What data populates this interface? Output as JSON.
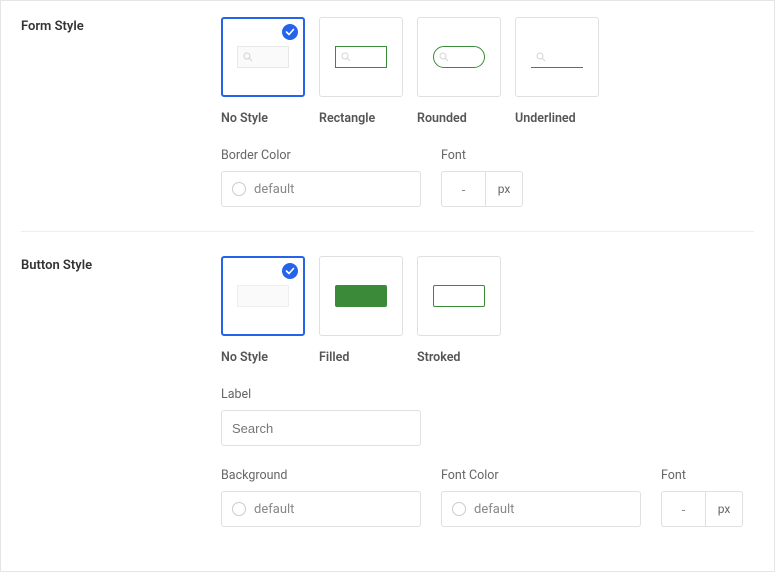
{
  "formStyle": {
    "sectionLabel": "Form Style",
    "options": {
      "noStyle": "No Style",
      "rectangle": "Rectangle",
      "rounded": "Rounded",
      "underlined": "Underlined"
    },
    "borderColor": {
      "label": "Border Color",
      "value": "default"
    },
    "font": {
      "label": "Font",
      "size": "-",
      "unit": "px"
    }
  },
  "buttonStyle": {
    "sectionLabel": "Button Style",
    "options": {
      "noStyle": "No Style",
      "filled": "Filled",
      "stroked": "Stroked"
    },
    "labelField": {
      "label": "Label",
      "placeholder": "Search"
    },
    "background": {
      "label": "Background",
      "value": "default"
    },
    "fontColor": {
      "label": "Font Color",
      "value": "default"
    },
    "font": {
      "label": "Font",
      "size": "-",
      "unit": "px"
    }
  }
}
